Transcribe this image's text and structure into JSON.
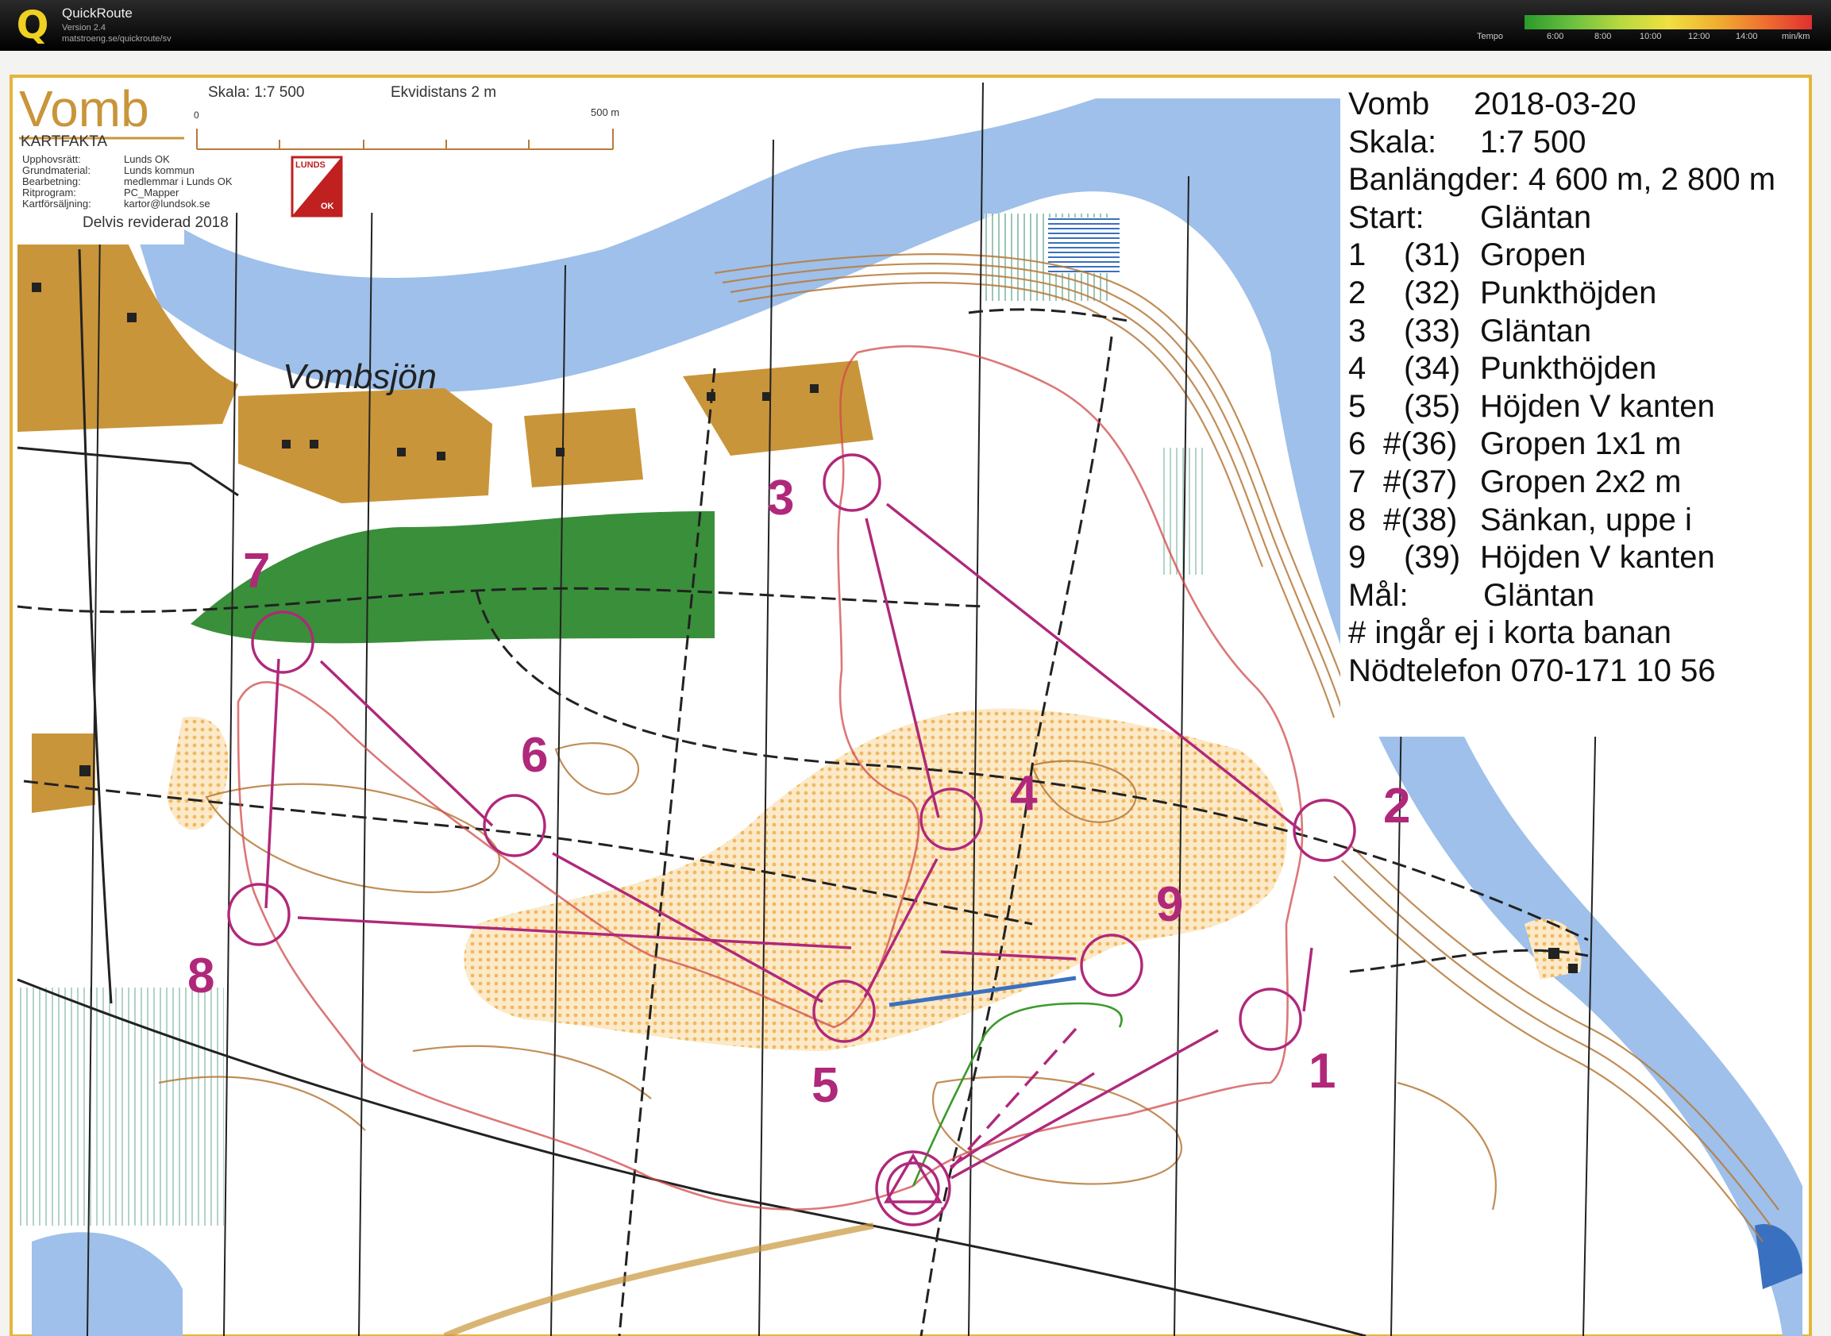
{
  "app": {
    "logo": "Q",
    "name": "QuickRoute",
    "version": "Version 2.4",
    "url": "matstroeng.se/quickroute/sv"
  },
  "legend": {
    "title": "Tempo",
    "unit": "min/km",
    "ticks": [
      "6:00",
      "8:00",
      "10:00",
      "12:00",
      "14:00"
    ]
  },
  "map": {
    "title": "Vomb",
    "scale_label": "Skala:  1:7 500",
    "contour_label": "Ekvidistans 2 m",
    "scalebar_start": "0",
    "scalebar_end": "500 m",
    "kartfakta_heading": "KARTFAKTA",
    "kartfakta": [
      {
        "k": "Upphovsrätt:",
        "v": "Lunds OK"
      },
      {
        "k": "Grundmaterial:",
        "v": "Lunds kommun"
      },
      {
        "k": "Bearbetning:",
        "v": "medlemmar i Lunds OK"
      },
      {
        "k": "Ritprogram:",
        "v": "PC_Mapper"
      },
      {
        "k": "Kartförsäljning:",
        "v": "kartor@lundsok.se"
      }
    ],
    "revised": "Delvis reviderad 2018",
    "club_logo_top": "LUNDS",
    "club_logo_bottom": "OK",
    "lake_name": "Vombsjön"
  },
  "course_info": {
    "title_left": "Vomb",
    "date": "2018-03-20",
    "scale_key": "Skala:",
    "scale_val": "1:7 500",
    "lengths": "Banlängder: 4 600 m, 2 800 m",
    "start_key": "Start:",
    "start_val": "Gläntan",
    "controls": [
      {
        "n": "1",
        "code": "(31)",
        "desc": "Gropen"
      },
      {
        "n": "2",
        "code": "(32)",
        "desc": "Punkthöjden"
      },
      {
        "n": "3",
        "code": "(33)",
        "desc": "Gläntan"
      },
      {
        "n": "4",
        "code": "(34)",
        "desc": "Punkthöjden"
      },
      {
        "n": "5",
        "code": "(35)",
        "desc": "Höjden V kanten"
      },
      {
        "n": "6",
        "code": "#(36)",
        "desc": "Gropen 1x1 m"
      },
      {
        "n": "7",
        "code": "#(37)",
        "desc": "Gropen 2x2 m"
      },
      {
        "n": "8",
        "code": "#(38)",
        "desc": "Sänkan, uppe i"
      },
      {
        "n": "9",
        "code": "(39)",
        "desc": "Höjden V kanten"
      }
    ],
    "finish_key": "Mål:",
    "finish_val": "Gläntan",
    "note": "# ingår ej i korta banan",
    "phone": "Nödtelefon 070-171 10 56"
  },
  "control_numbers": [
    "1",
    "2",
    "3",
    "4",
    "5",
    "6",
    "7",
    "8",
    "9"
  ],
  "colors": {
    "course": "#b0287a",
    "water": "#9ec0ea",
    "field": "#c9953a",
    "forest_green": "#3a8f3a",
    "route_green": "#3a9a2a",
    "route_red": "#d04a4a"
  }
}
